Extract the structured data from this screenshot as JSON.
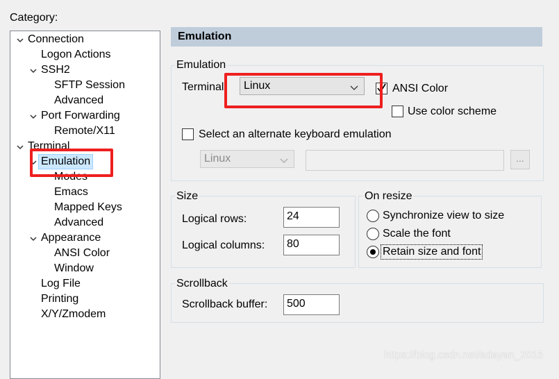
{
  "category_label": "Category:",
  "tree": [
    {
      "label": "Connection"
    },
    {
      "label": "Logon Actions"
    },
    {
      "label": "SSH2"
    },
    {
      "label": "SFTP Session"
    },
    {
      "label": "Advanced"
    },
    {
      "label": "Port Forwarding"
    },
    {
      "label": "Remote/X11"
    },
    {
      "label": "Terminal"
    },
    {
      "label": "Emulation"
    },
    {
      "label": "Modes"
    },
    {
      "label": "Emacs"
    },
    {
      "label": "Mapped Keys"
    },
    {
      "label": "Advanced"
    },
    {
      "label": "Appearance"
    },
    {
      "label": "ANSI Color"
    },
    {
      "label": "Window"
    },
    {
      "label": "Log File"
    },
    {
      "label": "Printing"
    },
    {
      "label": "X/Y/Zmodem"
    }
  ],
  "page_title": "Emulation",
  "emulation_group": {
    "title": "Emulation",
    "terminal_label": "Terminal:",
    "terminal_value": "Linux",
    "ansi_color_label": "ANSI Color",
    "ansi_color_checked": true,
    "use_color_scheme_label": "Use color scheme",
    "use_color_scheme_checked": false,
    "alt_keyboard_label": "Select an alternate keyboard emulation",
    "alt_keyboard_checked": false,
    "alt_keyboard_value": "Linux",
    "browse_label": "..."
  },
  "size_group": {
    "title": "Size",
    "rows_label": "Logical rows:",
    "rows_value": "24",
    "cols_label": "Logical columns:",
    "cols_value": "80"
  },
  "resize_group": {
    "title": "On resize",
    "options": [
      {
        "label": "Synchronize view to size",
        "selected": false
      },
      {
        "label": "Scale the font",
        "selected": false
      },
      {
        "label": "Retain size and font",
        "selected": true
      }
    ]
  },
  "scrollback_group": {
    "title": "Scrollback",
    "buffer_label": "Scrollback buffer:",
    "buffer_value": "500"
  },
  "watermark": "https://blog.csdn.net/adayan_2015",
  "colors": {
    "highlight_box": "#ee1f1f",
    "header_bg": "#bfcddb",
    "selection_bg": "#cce8ff"
  }
}
